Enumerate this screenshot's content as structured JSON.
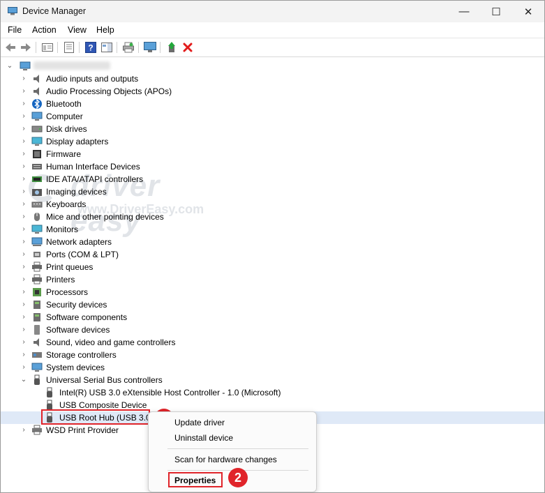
{
  "window": {
    "title": "Device Manager",
    "minimize": "—",
    "maximize": "☐",
    "close": "✕"
  },
  "menu": [
    "File",
    "Action",
    "View",
    "Help"
  ],
  "tree": {
    "categories": [
      "Audio inputs and outputs",
      "Audio Processing Objects (APOs)",
      "Bluetooth",
      "Computer",
      "Disk drives",
      "Display adapters",
      "Firmware",
      "Human Interface Devices",
      "IDE ATA/ATAPI controllers",
      "Imaging devices",
      "Keyboards",
      "Mice and other pointing devices",
      "Monitors",
      "Network adapters",
      "Ports (COM & LPT)",
      "Print queues",
      "Printers",
      "Processors",
      "Security devices",
      "Software components",
      "Software devices",
      "Sound, video and game controllers",
      "Storage controllers",
      "System devices"
    ],
    "usb_category": "Universal Serial Bus controllers",
    "usb_children": [
      "Intel(R) USB 3.0 eXtensible Host Controller - 1.0 (Microsoft)",
      "USB Composite Device",
      "USB Root Hub (USB 3.0)"
    ],
    "last_category": "WSD Print Provider"
  },
  "context_menu": {
    "update": "Update driver",
    "uninstall": "Uninstall device",
    "scan": "Scan for hardware changes",
    "properties": "Properties"
  },
  "annotations": {
    "step1": "1",
    "step2": "2"
  },
  "watermark": {
    "brand": "driver easy",
    "url": "www.DriverEasy.com"
  },
  "colors": {
    "highlight": "#e0242a",
    "delete": "#e21b1b"
  }
}
